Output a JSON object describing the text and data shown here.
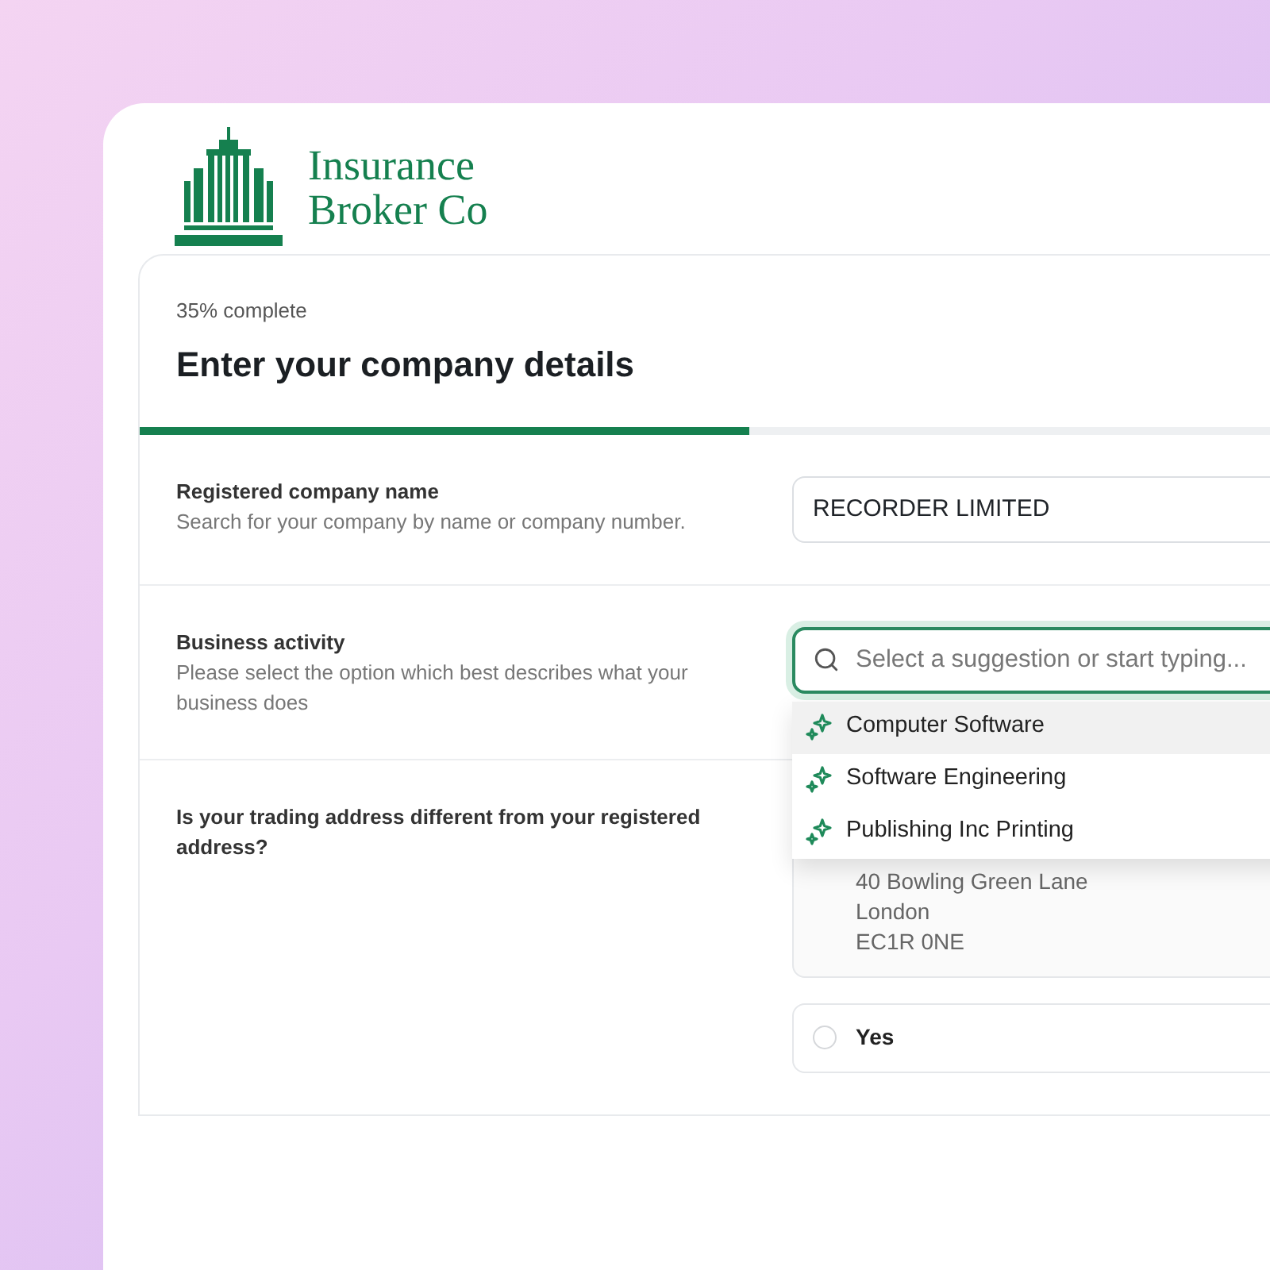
{
  "logo": {
    "lines": [
      "Insurance",
      "Broker Co"
    ]
  },
  "form": {
    "progress_label": "35% complete",
    "title": "Enter your company details",
    "progress": {
      "level": 0.35
    }
  },
  "fields": [
    {
      "kind": "text",
      "label": "Registered company name",
      "hint": "Search for your company by name or company number.",
      "value": "RECORDER LIMITED"
    },
    {
      "kind": "search",
      "label": "Business activity",
      "hint": "Please select the option which best describes what your business does",
      "placeholder": "Select a suggestion or start typing...",
      "focused": true,
      "suggestions": [
        {
          "label": "Computer Software",
          "selected": true
        },
        {
          "label": "Software Engineering",
          "selected": false
        },
        {
          "label": "Publishing Inc Printing",
          "selected": false
        }
      ]
    },
    {
      "kind": "address",
      "label": "Is your trading address different from your registered address?",
      "address_lines": [
        "40 Bowling Green Lane",
        "London",
        "EC1R 0NE"
      ],
      "options": [
        {
          "label": "Yes",
          "selected": false
        }
      ]
    }
  ]
}
